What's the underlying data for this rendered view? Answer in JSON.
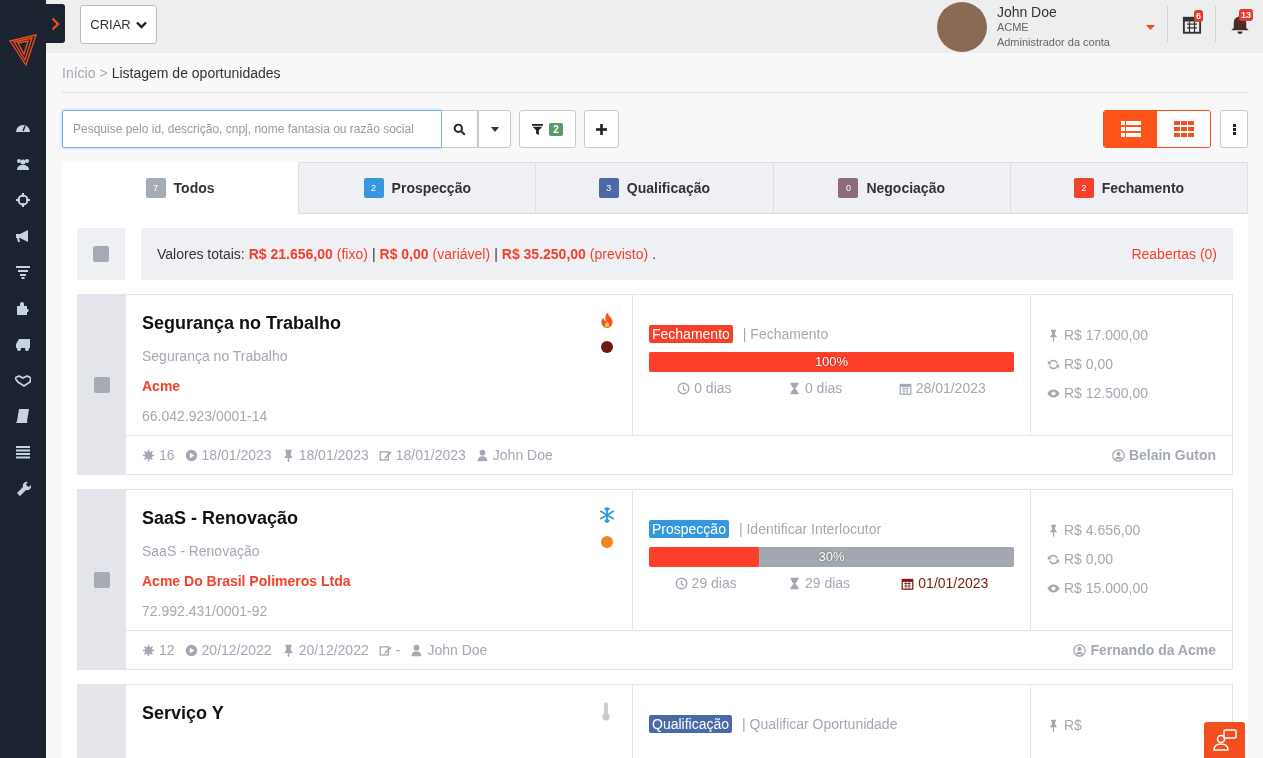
{
  "topbar": {
    "create_button": "CRIAR",
    "user": {
      "name": "John Doe",
      "company": "ACME",
      "role": "Administrador da conta"
    },
    "calendar_badge": "6",
    "notifications_badge": "13"
  },
  "breadcrumb": {
    "parent": "Início",
    "separator": ">",
    "current": "Listagem de oportunidades"
  },
  "search": {
    "placeholder": "Pesquise pelo id, descrição, cnpj, nome fantasia ou razão social"
  },
  "filter_badge": "2",
  "view_toggle": [
    {
      "kind": "list",
      "selected": true
    },
    {
      "kind": "grid",
      "selected": false
    }
  ],
  "tabs": [
    {
      "count": "7",
      "label": "Todos",
      "color": "#a4abb4",
      "selected": true
    },
    {
      "count": "2",
      "label": "Prospecção",
      "color": "#3598dc",
      "selected": false
    },
    {
      "count": "3",
      "label": "Qualificação",
      "color": "#4a69a5",
      "selected": false
    },
    {
      "count": "0",
      "label": "Negociação",
      "color": "#8c6a78",
      "selected": false
    },
    {
      "count": "2",
      "label": "Fechamento",
      "color": "#f5412a",
      "selected": false
    }
  ],
  "totals": {
    "label": "Valores totais:",
    "separator": "|",
    "items": [
      {
        "value": "R$ 21.656,00",
        "type": "(fixo)"
      },
      {
        "value": "R$ 0,00",
        "type": "(variável)"
      },
      {
        "value": "R$ 35.250,00",
        "type": "(previsto)"
      }
    ],
    "end": ".",
    "reopened": "Reabertas (0)",
    "checked": false
  },
  "opportunities": [
    {
      "title": "Segurança no Trabalho",
      "subtitle": "Segurança no Trabalho",
      "company": "Acme",
      "cnpj": "66.042.923/0001-14",
      "kind": "hot",
      "checked": false,
      "color": "#6b1a10",
      "stage": {
        "label": "Fechamento",
        "color": "#f5412a"
      },
      "step": "| Fechamento",
      "level": 1,
      "percent": "100%",
      "days_open": "0 dias",
      "days_stage": "0 dias",
      "date": "28/01/2023",
      "date_overdue": false,
      "footer": {
        "id": "16",
        "started": "18/01/2023",
        "pinned": "18/01/2023",
        "edited": "18/01/2023",
        "owner": "John Doe",
        "contact": "Belain Guton"
      },
      "values": {
        "fixed": "R$ 17.000,00",
        "recurring": "R$ 0,00",
        "forecast": "R$ 12.500,00"
      }
    },
    {
      "title": "SaaS - Renovação",
      "subtitle": "SaaS - Renovação",
      "company": "Acme Do Brasil Polimeros Ltda",
      "cnpj": "72.992.431/0001-92",
      "kind": "cold",
      "checked": false,
      "color": "#f5841f",
      "stage": {
        "label": "Prospecção",
        "color": "#3598dc"
      },
      "step": "| Identificar Interlocutor",
      "level": 0.3,
      "percent": "30%",
      "days_open": "29 dias",
      "days_stage": "29 dias",
      "date": "01/01/2023",
      "date_overdue": true,
      "footer": {
        "id": "12",
        "started": "20/12/2022",
        "pinned": "20/12/2022",
        "edited": "-",
        "owner": "John Doe",
        "contact": "Fernando da Acme"
      },
      "values": {
        "fixed": "R$ 4.656,00",
        "recurring": "R$ 0,00",
        "forecast": "R$ 15.000,00"
      }
    },
    {
      "title": "Serviço Y",
      "kind": "neutral",
      "stage": {
        "label": "Qualificação",
        "color": "#4a69a5"
      },
      "step": "| Qualificar Oportunidade",
      "values": {
        "fixed": "R$"
      }
    }
  ]
}
